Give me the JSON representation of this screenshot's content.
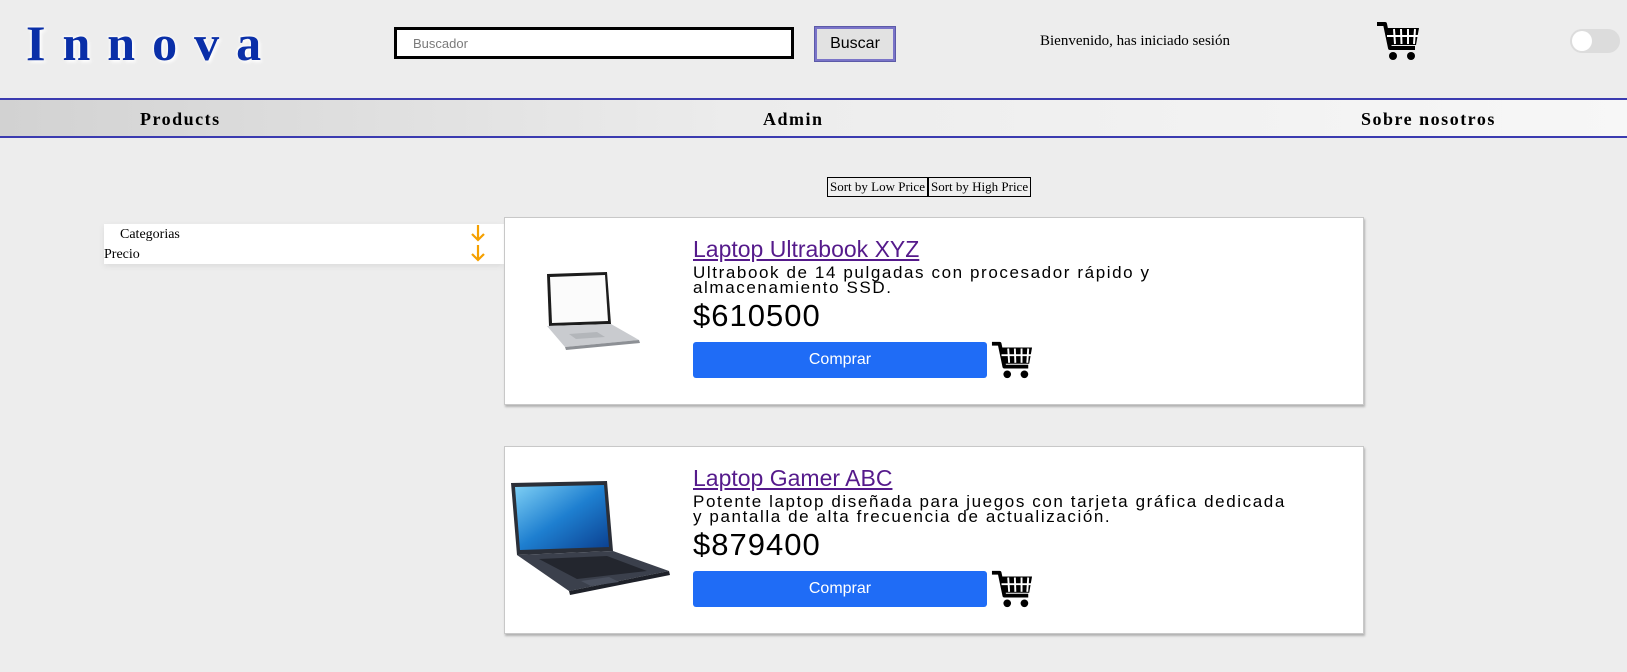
{
  "brand": {
    "logo": "Innova"
  },
  "search": {
    "placeholder": "Buscador",
    "value": "",
    "button_label": "Buscar"
  },
  "header": {
    "welcome": "Bienvenido, has iniciado sesión",
    "cart_icon": "cart-icon",
    "toggle_on": false
  },
  "nav": {
    "items": [
      {
        "label": "Products"
      },
      {
        "label": "Admin"
      },
      {
        "label": "Sobre nosotros"
      }
    ]
  },
  "sort": {
    "low_label": "Sort by Low Price",
    "high_label": "Sort by High Price"
  },
  "filters": {
    "items": [
      {
        "label": "Categorias",
        "icon": "arrow-down-icon"
      },
      {
        "label": "Precio",
        "icon": "arrow-down-icon"
      }
    ],
    "arrow_color": "#f5a000"
  },
  "products": [
    {
      "title": "Laptop Ultrabook XYZ",
      "description": "Ultrabook de 14 pulgadas con procesador rápido y almacenamiento SSD.",
      "price": "$610500",
      "buy_label": "Comprar",
      "image": "ultrabook-laptop-image"
    },
    {
      "title": "Laptop Gamer ABC",
      "description": "Potente laptop diseñada para juegos con tarjeta gráfica dedicada y pantalla de alta frecuencia de actualización.",
      "price": "$879400",
      "buy_label": "Comprar",
      "image": "gamer-laptop-image"
    }
  ],
  "colors": {
    "logo": "#0a2fa8",
    "button": "#1f6cf6",
    "nav_border": "#3b3bb0",
    "link_visited": "#551a8b"
  }
}
